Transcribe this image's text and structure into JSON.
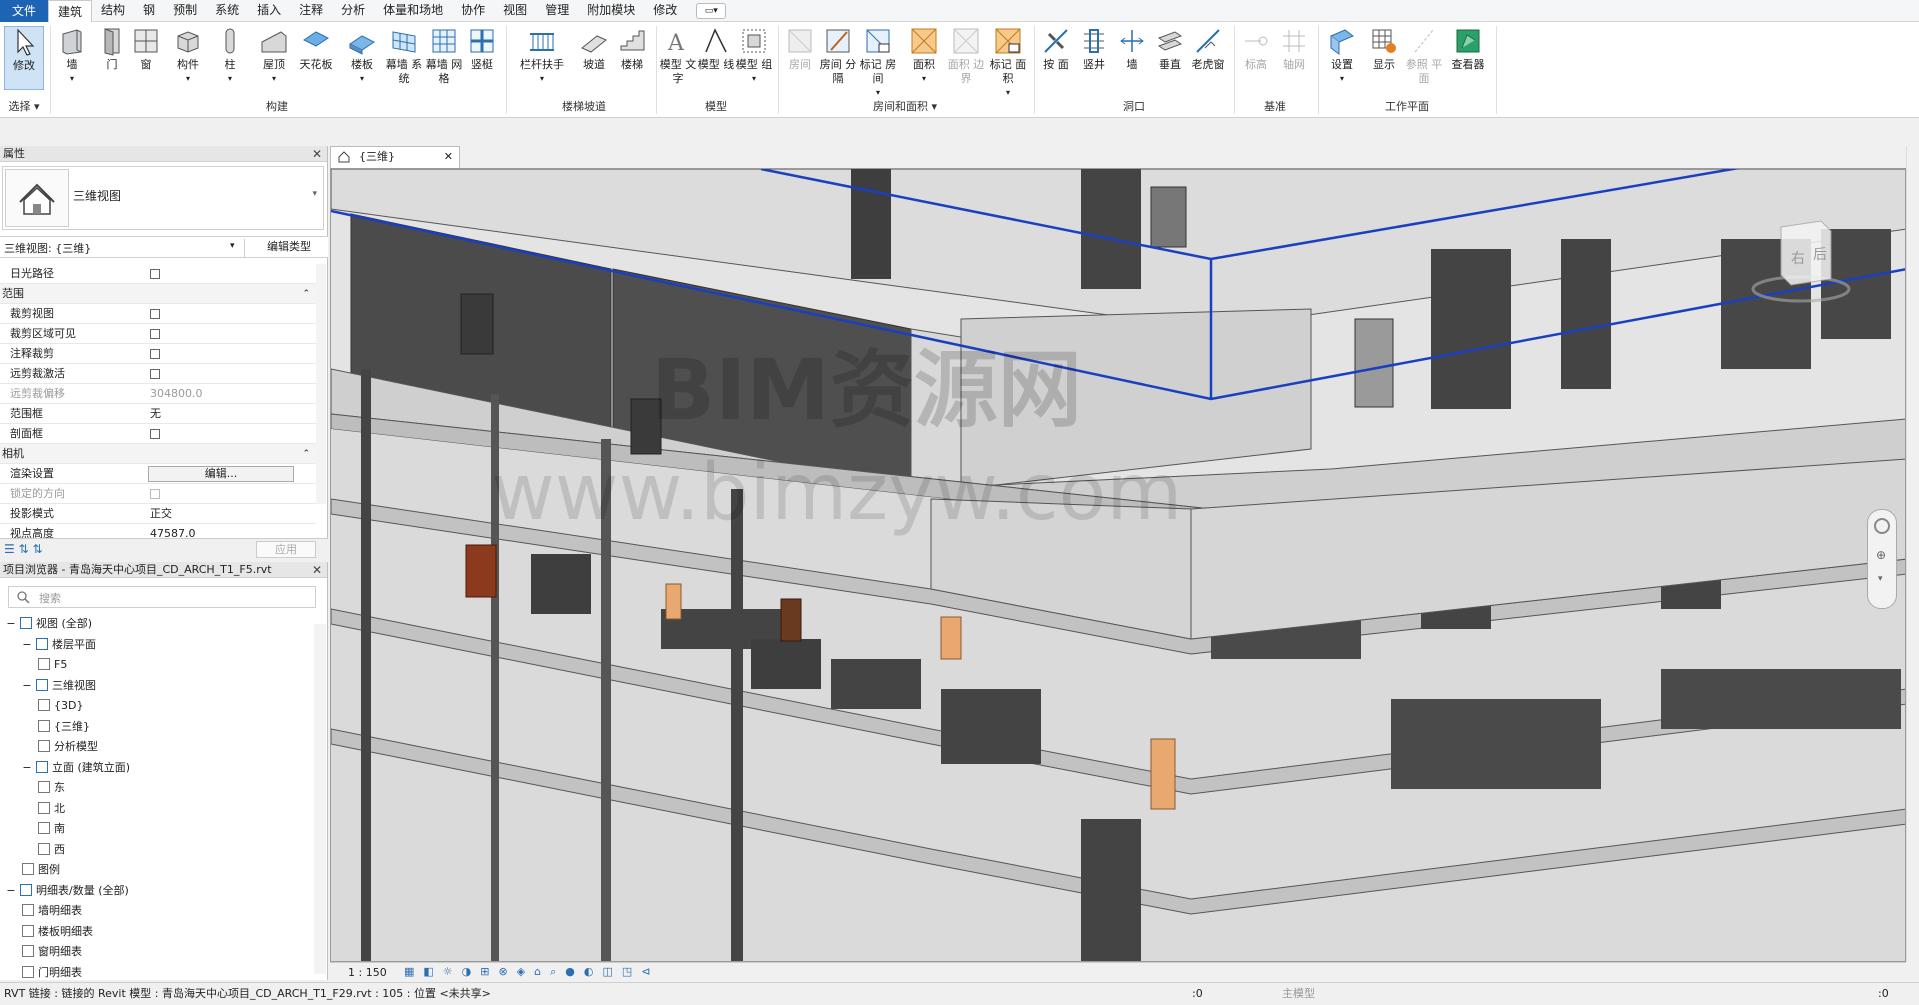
{
  "menu": {
    "file": "文件",
    "tabs": [
      "建筑",
      "结构",
      "钢",
      "预制",
      "系统",
      "插入",
      "注释",
      "分析",
      "体量和场地",
      "协作",
      "视图",
      "管理",
      "附加模块",
      "修改"
    ],
    "active_tab": "建筑"
  },
  "ribbon": {
    "tools": {
      "modify": "修改",
      "wall": "墙",
      "door": "门",
      "window": "窗",
      "component": "构件",
      "column": "柱",
      "roof": "屋顶",
      "ceiling": "天花板",
      "floor": "楼板",
      "curtain_system": "幕墙 系统",
      "curtain_grid": "幕墙 网格",
      "mullion": "竖梃",
      "railing": "栏杆扶手",
      "ramp": "坡道",
      "stair": "楼梯",
      "model_text": "模型 文字",
      "model_line": "模型 线",
      "model_group": "模型 组",
      "room": "房间",
      "room_separator": "房间 分隔",
      "tag_room": "标记 房间",
      "area": "面积",
      "area_boundary": "面积 边界",
      "tag_area": "标记 面积",
      "by_face": "按 面",
      "shaft": "竖井",
      "wall_opening": "墙",
      "vertical": "垂直",
      "dormer": "老虎窗",
      "level": "标高",
      "grid": "轴网",
      "set": "设置",
      "show": "显示",
      "ref_plane": "参照 平面",
      "viewer": "查看器"
    },
    "groups": {
      "select": "选择",
      "build": "构建",
      "circulation": "楼梯坡道",
      "model": "模型",
      "room_area": "房间和面积",
      "opening": "洞口",
      "datum": "基准",
      "work_plane": "工作平面"
    }
  },
  "properties": {
    "title": "属性",
    "type_name": "三维视图",
    "view_selector": "三维视图: {三维}",
    "edit_type": "编辑类型",
    "rows": [
      {
        "k": "日光路径",
        "v": "",
        "cb": true
      },
      {
        "k": "范围",
        "sec": true
      },
      {
        "k": "裁剪视图",
        "cb": true
      },
      {
        "k": "裁剪区域可见",
        "cb": true
      },
      {
        "k": "注释裁剪",
        "cb": true
      },
      {
        "k": "远剪裁激活",
        "cb": true
      },
      {
        "k": "远剪裁偏移",
        "v": "304800.0",
        "dim": true
      },
      {
        "k": "范围框",
        "v": "无"
      },
      {
        "k": "剖面框",
        "cb": true
      },
      {
        "k": "相机",
        "sec": true
      },
      {
        "k": "渲染设置",
        "btn": "编辑..."
      },
      {
        "k": "锁定的方向",
        "cb": true,
        "dim": true
      },
      {
        "k": "投影模式",
        "v": "正交"
      },
      {
        "k": "视点高度",
        "v": "47587.0"
      }
    ],
    "apply": "应用"
  },
  "browser": {
    "title": "项目浏览器 - 青岛海天中心项目_CD_ARCH_T1_F5.rvt",
    "search_placeholder": "搜索",
    "items": [
      {
        "label": "视图 (全部)",
        "level": 0,
        "toggle": "−"
      },
      {
        "label": "楼层平面",
        "level": 1,
        "toggle": "−"
      },
      {
        "label": "F5",
        "level": 2,
        "box": true
      },
      {
        "label": "三维视图",
        "level": 1,
        "toggle": "−"
      },
      {
        "label": "{3D}",
        "level": 2,
        "box": true
      },
      {
        "label": "{三维}",
        "level": 2,
        "box": true
      },
      {
        "label": "分析模型",
        "level": 2,
        "box": true
      },
      {
        "label": "立面 (建筑立面)",
        "level": 1,
        "toggle": "−"
      },
      {
        "label": "东",
        "level": 2,
        "box": true
      },
      {
        "label": "北",
        "level": 2,
        "box": true
      },
      {
        "label": "南",
        "level": 2,
        "box": true
      },
      {
        "label": "西",
        "level": 2,
        "box": true
      },
      {
        "label": "图例",
        "level": 1,
        "box": true
      },
      {
        "label": "明细表/数量 (全部)",
        "level": 0,
        "toggle": "−"
      },
      {
        "label": "墙明细表",
        "level": 1,
        "box": true
      },
      {
        "label": "楼板明细表",
        "level": 1,
        "box": true
      },
      {
        "label": "窗明细表",
        "level": 1,
        "box": true
      },
      {
        "label": "门明细表",
        "level": 1,
        "box": true
      }
    ]
  },
  "view": {
    "tab_label": "{三维}",
    "scale": "1 : 150",
    "watermark1": "BIM资源网",
    "watermark2": "www.bimzyw.com",
    "viewcube_right": "右",
    "viewcube_back": "后"
  },
  "status": {
    "message": "RVT 链接 : 链接的 Revit 模型 : 青岛海天中心项目_CD_ARCH_T1_F29.rvt : 105 : 位置 <未共享>",
    "zero": ":0",
    "model": "主模型",
    "filter_count": ":0"
  },
  "colors": {
    "file_tab": "#1e64b4",
    "section_box": "#1a3fc0",
    "door_wood": "#8b3a1e",
    "door_light": "#e8a870",
    "wall_dark": "#4a4a4a",
    "slab_light": "#d8d8d8"
  }
}
